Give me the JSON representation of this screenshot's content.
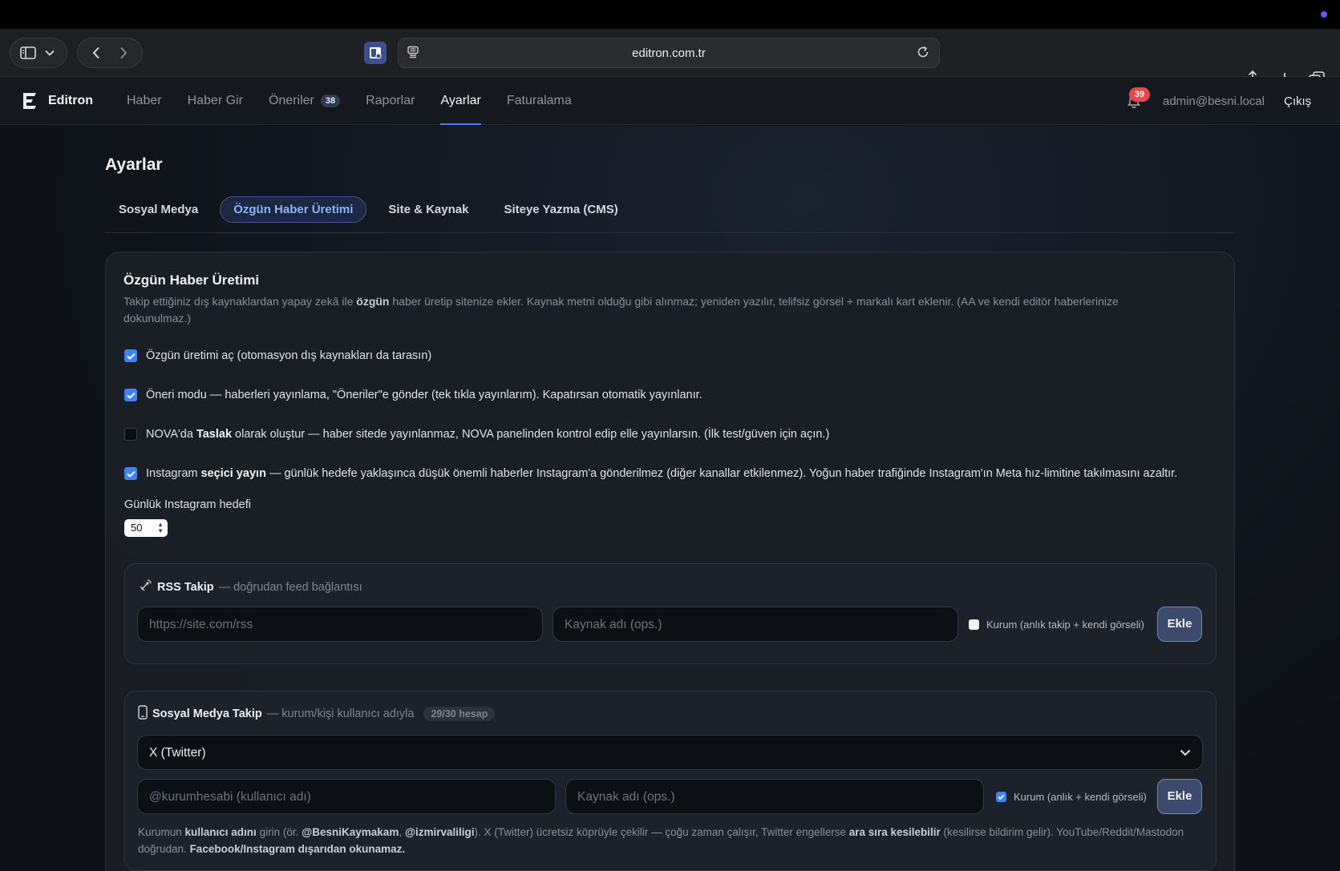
{
  "browser": {
    "url": "editron.com.tr"
  },
  "header": {
    "brand": "Editron",
    "nav": [
      {
        "label": "Haber"
      },
      {
        "label": "Haber Gir"
      },
      {
        "label": "Öneriler",
        "badge": "38"
      },
      {
        "label": "Raporlar"
      },
      {
        "label": "Ayarlar",
        "active": true
      },
      {
        "label": "Faturalama"
      }
    ],
    "notifications": "39",
    "user_email": "admin@besni.local",
    "logout": "Çıkış"
  },
  "page": {
    "title": "Ayarlar",
    "tabs": [
      {
        "label": "Sosyal Medya"
      },
      {
        "label": "Özgün Haber Üretimi",
        "active": true
      },
      {
        "label": "Site & Kaynak"
      },
      {
        "label": "Siteye Yazma (CMS)"
      }
    ]
  },
  "card": {
    "title": "Özgün Haber Üretimi",
    "desc_1": "Takip ettiğiniz dış kaynaklardan yapay zekâ ile ",
    "desc_bold": "özgün",
    "desc_2": " haber üretip sitenize ekler. Kaynak metni olduğu gibi alınmaz; yeniden yazılır, telifsiz görsel + markalı kart eklenir. (AA ve kendi editör haberlerinize dokunulmaz.)",
    "options": [
      {
        "checked": true,
        "text": "Özgün üretimi aç (otomasyon dış kaynakları da tarasın)"
      },
      {
        "checked": true,
        "text": "Öneri modu — haberleri yayınlama, \"Öneriler\"e gönder (tek tıkla yayınlarım). Kapatırsan otomatik yayınlanır."
      },
      {
        "checked": false,
        "pre": "NOVA'da ",
        "bold": "Taslak",
        "post": " olarak oluştur — haber sitede yayınlanmaz, NOVA panelinden kontrol edip elle yayınlarsın. (İlk test/güven için açın.)"
      },
      {
        "checked": true,
        "pre": "Instagram ",
        "bold": "seçici yayın",
        "post": " — günlük hedefe yaklaşınca düşük önemli haberler Instagram'a gönderilmez (diğer kanallar etkilenmez). Yoğun haber trafiğinde Instagram'ın Meta hız-limitine takılmasını azaltır."
      }
    ],
    "instagram_target_label": "Günlük Instagram hedefi",
    "instagram_target_value": "50"
  },
  "rss": {
    "title": "RSS Takip",
    "subtitle": "— doğrudan feed bağlantısı",
    "url_placeholder": "https://site.com/rss",
    "name_placeholder": "Kaynak adı (ops.)",
    "checkbox_label": "Kurum (anlık takip + kendi görseli)",
    "checkbox_checked": false,
    "add_label": "Ekle"
  },
  "social": {
    "title": "Sosyal Medya Takip",
    "subtitle": "— kurum/kişi kullanıcı adıyla",
    "count": "29/30 hesap",
    "platform": "X (Twitter)",
    "handle_placeholder": "@kurumhesabi (kullanıcı adı)",
    "name_placeholder": "Kaynak adı (ops.)",
    "checkbox_label": "Kurum (anlık + kendi görseli)",
    "checkbox_checked": true,
    "add_label": "Ekle",
    "help_1": "Kurumun ",
    "help_b1": "kullanıcı adını",
    "help_2": " girin (ör. ",
    "help_b2": "@BesniKaymakam",
    "help_3": ", ",
    "help_b3": "@izmirvaliligi",
    "help_4": "). X (Twitter) ücretsiz köprüyle çekilir — çoğu zaman çalışır, Twitter engellerse ",
    "help_b4": "ara sıra kesilebilir",
    "help_5": " (kesilirse bildirim gelir). YouTube/Reddit/Mastodon doğrudan. ",
    "help_b5": "Facebook/Instagram dışarıdan okunamaz."
  },
  "colors": {
    "accent": "#3d82f6",
    "active_tab": "#8fb0ff",
    "badge_red": "#e5484d"
  }
}
